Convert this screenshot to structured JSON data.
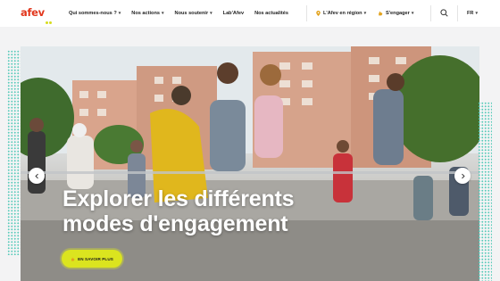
{
  "brand": {
    "logo_text": "afev",
    "accent": "#e2371d",
    "dot_color": "#d7dc1d"
  },
  "nav": {
    "items": [
      {
        "label": "Qui sommes-nous ?",
        "has_dropdown": true
      },
      {
        "label": "Nos actions",
        "has_dropdown": true
      },
      {
        "label": "Nous soutenir",
        "has_dropdown": true
      },
      {
        "label": "Lab'Afev",
        "has_dropdown": false
      },
      {
        "label": "Nos actualités",
        "has_dropdown": false
      }
    ],
    "region_label": "L'Afev en région",
    "engage_label": "S'engager",
    "language": "FR"
  },
  "hero": {
    "title_line1": "Explorer les différents",
    "title_line2": "modes d'engagement",
    "cta_label": "EN SAVOIR PLUS",
    "cta_color": "#dbe41f",
    "dots_color": "#48c6b4"
  },
  "icons": {
    "region": "location-pin-icon",
    "engage": "hand-icon",
    "search": "search-icon",
    "prev": "chevron-left-icon",
    "next": "chevron-right-icon"
  }
}
